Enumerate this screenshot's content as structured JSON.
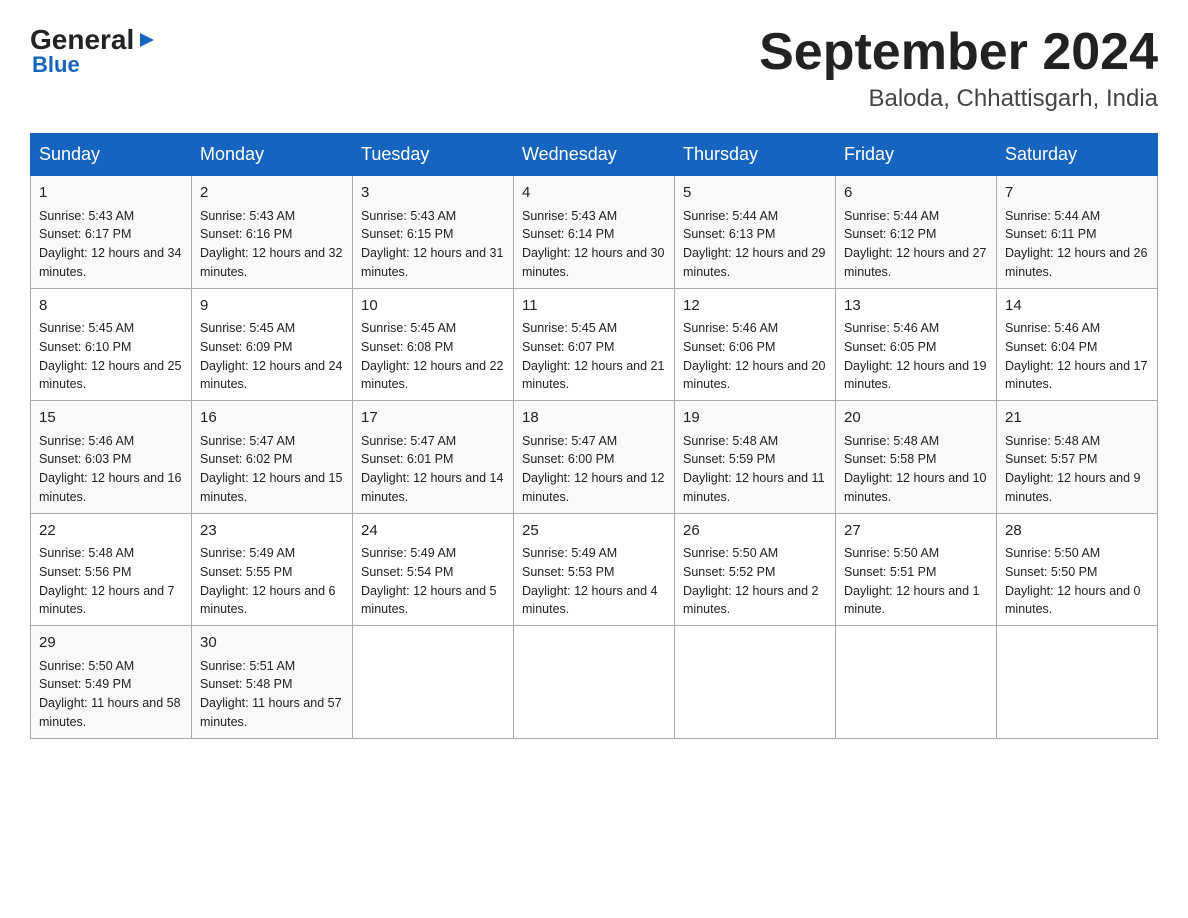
{
  "header": {
    "logo": {
      "general": "General",
      "blue": "Blue",
      "tagline": "Blue"
    },
    "title": "September 2024",
    "location": "Baloda, Chhattisgarh, India"
  },
  "days_of_week": [
    "Sunday",
    "Monday",
    "Tuesday",
    "Wednesday",
    "Thursday",
    "Friday",
    "Saturday"
  ],
  "weeks": [
    [
      {
        "day": "1",
        "sunrise": "5:43 AM",
        "sunset": "6:17 PM",
        "daylight": "12 hours and 34 minutes."
      },
      {
        "day": "2",
        "sunrise": "5:43 AM",
        "sunset": "6:16 PM",
        "daylight": "12 hours and 32 minutes."
      },
      {
        "day": "3",
        "sunrise": "5:43 AM",
        "sunset": "6:15 PM",
        "daylight": "12 hours and 31 minutes."
      },
      {
        "day": "4",
        "sunrise": "5:43 AM",
        "sunset": "6:14 PM",
        "daylight": "12 hours and 30 minutes."
      },
      {
        "day": "5",
        "sunrise": "5:44 AM",
        "sunset": "6:13 PM",
        "daylight": "12 hours and 29 minutes."
      },
      {
        "day": "6",
        "sunrise": "5:44 AM",
        "sunset": "6:12 PM",
        "daylight": "12 hours and 27 minutes."
      },
      {
        "day": "7",
        "sunrise": "5:44 AM",
        "sunset": "6:11 PM",
        "daylight": "12 hours and 26 minutes."
      }
    ],
    [
      {
        "day": "8",
        "sunrise": "5:45 AM",
        "sunset": "6:10 PM",
        "daylight": "12 hours and 25 minutes."
      },
      {
        "day": "9",
        "sunrise": "5:45 AM",
        "sunset": "6:09 PM",
        "daylight": "12 hours and 24 minutes."
      },
      {
        "day": "10",
        "sunrise": "5:45 AM",
        "sunset": "6:08 PM",
        "daylight": "12 hours and 22 minutes."
      },
      {
        "day": "11",
        "sunrise": "5:45 AM",
        "sunset": "6:07 PM",
        "daylight": "12 hours and 21 minutes."
      },
      {
        "day": "12",
        "sunrise": "5:46 AM",
        "sunset": "6:06 PM",
        "daylight": "12 hours and 20 minutes."
      },
      {
        "day": "13",
        "sunrise": "5:46 AM",
        "sunset": "6:05 PM",
        "daylight": "12 hours and 19 minutes."
      },
      {
        "day": "14",
        "sunrise": "5:46 AM",
        "sunset": "6:04 PM",
        "daylight": "12 hours and 17 minutes."
      }
    ],
    [
      {
        "day": "15",
        "sunrise": "5:46 AM",
        "sunset": "6:03 PM",
        "daylight": "12 hours and 16 minutes."
      },
      {
        "day": "16",
        "sunrise": "5:47 AM",
        "sunset": "6:02 PM",
        "daylight": "12 hours and 15 minutes."
      },
      {
        "day": "17",
        "sunrise": "5:47 AM",
        "sunset": "6:01 PM",
        "daylight": "12 hours and 14 minutes."
      },
      {
        "day": "18",
        "sunrise": "5:47 AM",
        "sunset": "6:00 PM",
        "daylight": "12 hours and 12 minutes."
      },
      {
        "day": "19",
        "sunrise": "5:48 AM",
        "sunset": "5:59 PM",
        "daylight": "12 hours and 11 minutes."
      },
      {
        "day": "20",
        "sunrise": "5:48 AM",
        "sunset": "5:58 PM",
        "daylight": "12 hours and 10 minutes."
      },
      {
        "day": "21",
        "sunrise": "5:48 AM",
        "sunset": "5:57 PM",
        "daylight": "12 hours and 9 minutes."
      }
    ],
    [
      {
        "day": "22",
        "sunrise": "5:48 AM",
        "sunset": "5:56 PM",
        "daylight": "12 hours and 7 minutes."
      },
      {
        "day": "23",
        "sunrise": "5:49 AM",
        "sunset": "5:55 PM",
        "daylight": "12 hours and 6 minutes."
      },
      {
        "day": "24",
        "sunrise": "5:49 AM",
        "sunset": "5:54 PM",
        "daylight": "12 hours and 5 minutes."
      },
      {
        "day": "25",
        "sunrise": "5:49 AM",
        "sunset": "5:53 PM",
        "daylight": "12 hours and 4 minutes."
      },
      {
        "day": "26",
        "sunrise": "5:50 AM",
        "sunset": "5:52 PM",
        "daylight": "12 hours and 2 minutes."
      },
      {
        "day": "27",
        "sunrise": "5:50 AM",
        "sunset": "5:51 PM",
        "daylight": "12 hours and 1 minute."
      },
      {
        "day": "28",
        "sunrise": "5:50 AM",
        "sunset": "5:50 PM",
        "daylight": "12 hours and 0 minutes."
      }
    ],
    [
      {
        "day": "29",
        "sunrise": "5:50 AM",
        "sunset": "5:49 PM",
        "daylight": "11 hours and 58 minutes."
      },
      {
        "day": "30",
        "sunrise": "5:51 AM",
        "sunset": "5:48 PM",
        "daylight": "11 hours and 57 minutes."
      },
      null,
      null,
      null,
      null,
      null
    ]
  ]
}
